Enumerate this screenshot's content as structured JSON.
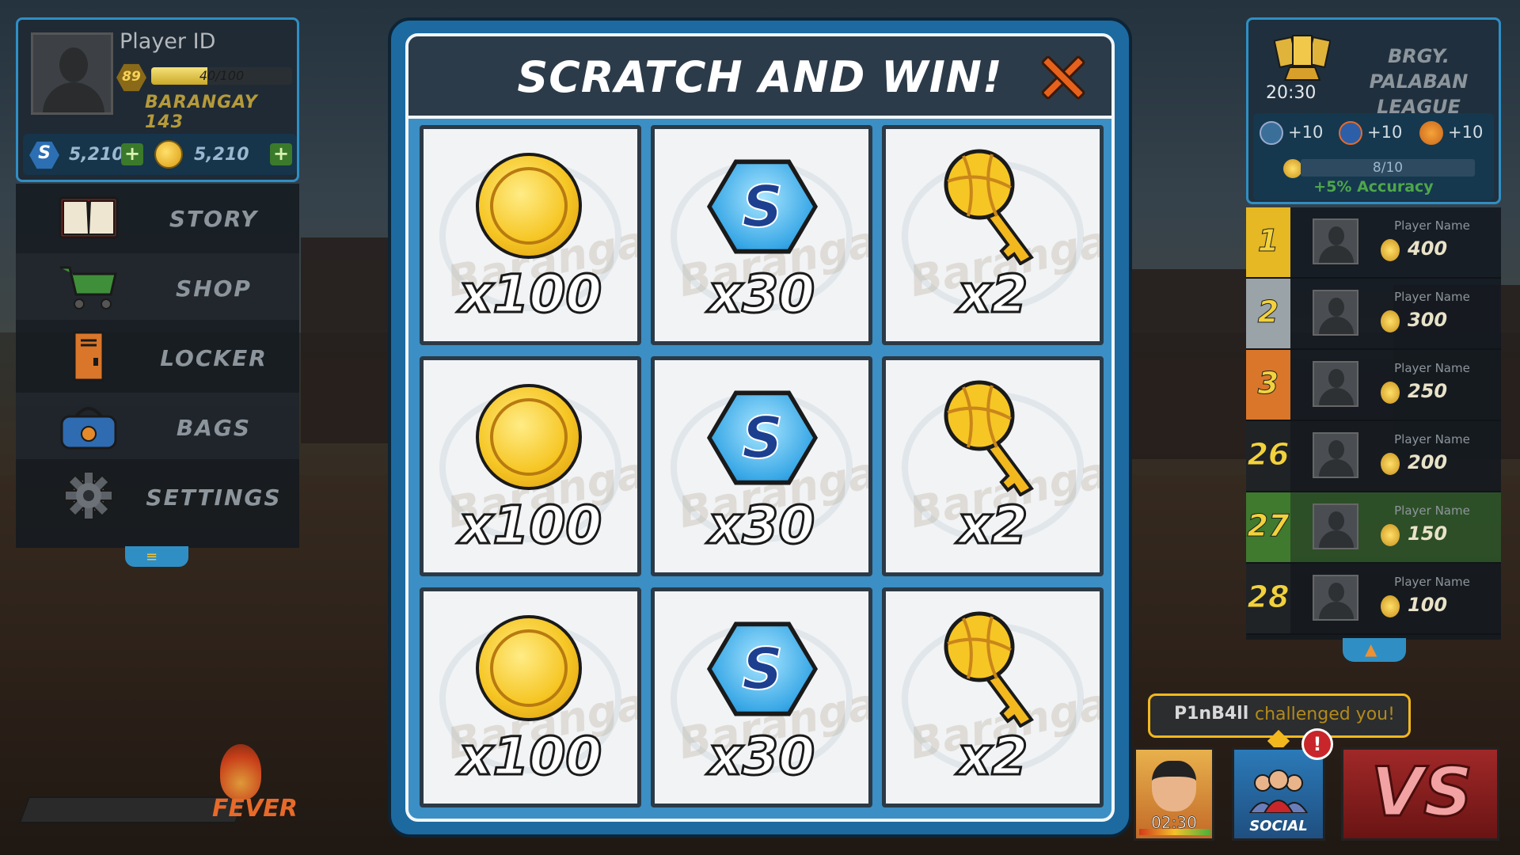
{
  "profile": {
    "player_id": "Player ID",
    "level": "89",
    "xp_text": "40/100",
    "xp_fraction": 0.4,
    "barangay": "BARANGAY 143",
    "gems": "5,210",
    "coins": "5,210",
    "gem_icon_letter": "S",
    "plus": "+"
  },
  "menu": {
    "items": [
      {
        "label": "STORY",
        "icon": "book-icon"
      },
      {
        "label": "SHOP",
        "icon": "shopping-cart-icon"
      },
      {
        "label": "LOCKER",
        "icon": "locker-icon"
      },
      {
        "label": "BAGS",
        "icon": "bag-icon"
      },
      {
        "label": "SETTINGS",
        "icon": "gear-icon"
      }
    ],
    "handle_icon": "≡"
  },
  "fever": {
    "label": "FEVER"
  },
  "league": {
    "time": "20:30",
    "name_line1": "BRGY. PALABAN",
    "name_line2": "LEAGUE",
    "stat1": "+10",
    "stat2": "+10",
    "stat3": "+10",
    "accuracy_progress": "8/10",
    "accuracy_fraction": 0.8,
    "accuracy_bonus": "+5% Accuracy"
  },
  "leaderboard": {
    "rows": [
      {
        "rank": "1",
        "name": "Player Name",
        "score": "400",
        "color": "#e5b824"
      },
      {
        "rank": "2",
        "name": "Player Name",
        "score": "300",
        "color": "#9aa3a8"
      },
      {
        "rank": "3",
        "name": "Player Name",
        "score": "250",
        "color": "#d9762a"
      },
      {
        "rank": "26",
        "name": "Player Name",
        "score": "200",
        "color": "#1f2326"
      },
      {
        "rank": "27",
        "name": "Player Name",
        "score": "150",
        "color": "#3f7a2e"
      },
      {
        "rank": "28",
        "name": "Player Name",
        "score": "100",
        "color": "#1f2326"
      }
    ],
    "handle_icon": "▲"
  },
  "challenge": {
    "challenger": "P1nB4ll",
    "text": "challenged you!"
  },
  "buttons": {
    "character_timer": "02:30",
    "social_label": "SOCIAL",
    "alert": "!",
    "vs_label": "VS"
  },
  "modal": {
    "title": "SCRATCH AND WIN!",
    "watermark": "Barangay",
    "tiles": [
      {
        "reward": "coin",
        "qty": "x100"
      },
      {
        "reward": "gem",
        "qty": "x30",
        "letter": "S"
      },
      {
        "reward": "key",
        "qty": "x2"
      },
      {
        "reward": "coin",
        "qty": "x100"
      },
      {
        "reward": "gem",
        "qty": "x30",
        "letter": "S"
      },
      {
        "reward": "key",
        "qty": "x2"
      },
      {
        "reward": "coin",
        "qty": "x100"
      },
      {
        "reward": "gem",
        "qty": "x30",
        "letter": "S"
      },
      {
        "reward": "key",
        "qty": "x2"
      }
    ]
  },
  "colors": {
    "accent_blue": "#2f8fc4",
    "gold": "#f2b81e",
    "close_orange": "#e6611c"
  }
}
